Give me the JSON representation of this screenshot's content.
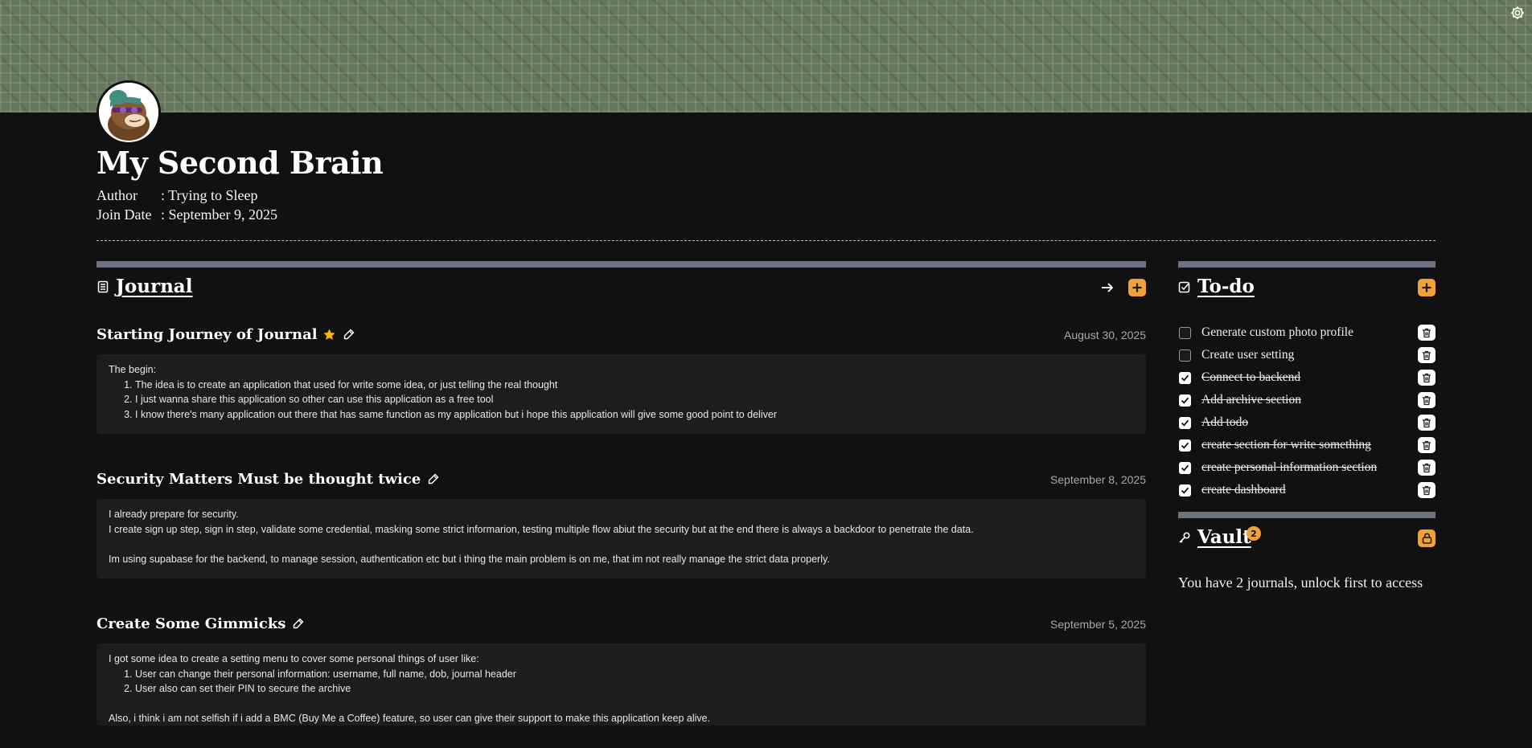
{
  "header": {
    "title": "My Second Brain",
    "author_label": "Author",
    "author_value": ": Trying to Sleep",
    "join_label": "Join Date",
    "join_value": ": September 9, 2025"
  },
  "icons": {
    "settings": "gear-icon",
    "journal": "document-icon",
    "open_journal": "arrow-right-icon",
    "add": "plus-icon",
    "favorite": "star-icon",
    "edit": "pencil-icon",
    "todo": "checkbox-icon",
    "delete": "trash-icon",
    "vault": "key-icon",
    "lock": "lock-icon"
  },
  "colors": {
    "accent": "#f2a13a",
    "background": "#111112",
    "card": "#1d1d1f",
    "bar": "#6e7381",
    "banner": "#66785c",
    "star": "#f5b500"
  },
  "journal": {
    "label": "Journal",
    "entries": [
      {
        "title": "Starting Journey of Journal",
        "favorite": true,
        "date": "August 30, 2025",
        "intro": "The begin:",
        "list": [
          "The idea is to create an application that used for write some idea, or just telling the real thought",
          "I just wanna share this application so other can use this application as a free tool",
          "I know there's many application out there that has same function as my application but i hope this application will give some good point to deliver"
        ]
      },
      {
        "title": "Security Matters Must be thought twice",
        "favorite": false,
        "date": "September 8, 2025",
        "line1": "I already prepare for security.",
        "line2": "I create sign up step, sign in step, validate some credential, masking some strict informarion, testing multiple flow abiut the security but at the end there is always a backdoor to penetrate the data.",
        "line3": "Im using supabase for the backend, to manage session, authentication etc but i thing the main problem is on me, that im not really manage the strict data properly."
      },
      {
        "title": "Create Some Gimmicks",
        "favorite": false,
        "date": "September 5, 2025",
        "intro": "I got some idea to create a setting menu to cover some personal things of user like:",
        "list": [
          "User can change their personal information: username, full name, dob, journal header",
          "User also can set their PIN to secure the archive"
        ],
        "outro": "Also, i think i am not selfish if i add a BMC (Buy Me a Coffee) feature, so user can give their support to make this application keep alive."
      }
    ]
  },
  "todo": {
    "label": "To-do",
    "items": [
      {
        "text": "Generate custom photo profile",
        "done": false
      },
      {
        "text": "Create user setting",
        "done": false
      },
      {
        "text": "Connect to backend",
        "done": true
      },
      {
        "text": "Add archive section",
        "done": true
      },
      {
        "text": "Add todo",
        "done": true
      },
      {
        "text": "create section for write something",
        "done": true
      },
      {
        "text": "create personal information section",
        "done": true
      },
      {
        "text": "create dashboard",
        "done": true
      }
    ]
  },
  "vault": {
    "label": "Vault",
    "badge": "2",
    "message": "You have 2 journals, unlock first to access"
  }
}
